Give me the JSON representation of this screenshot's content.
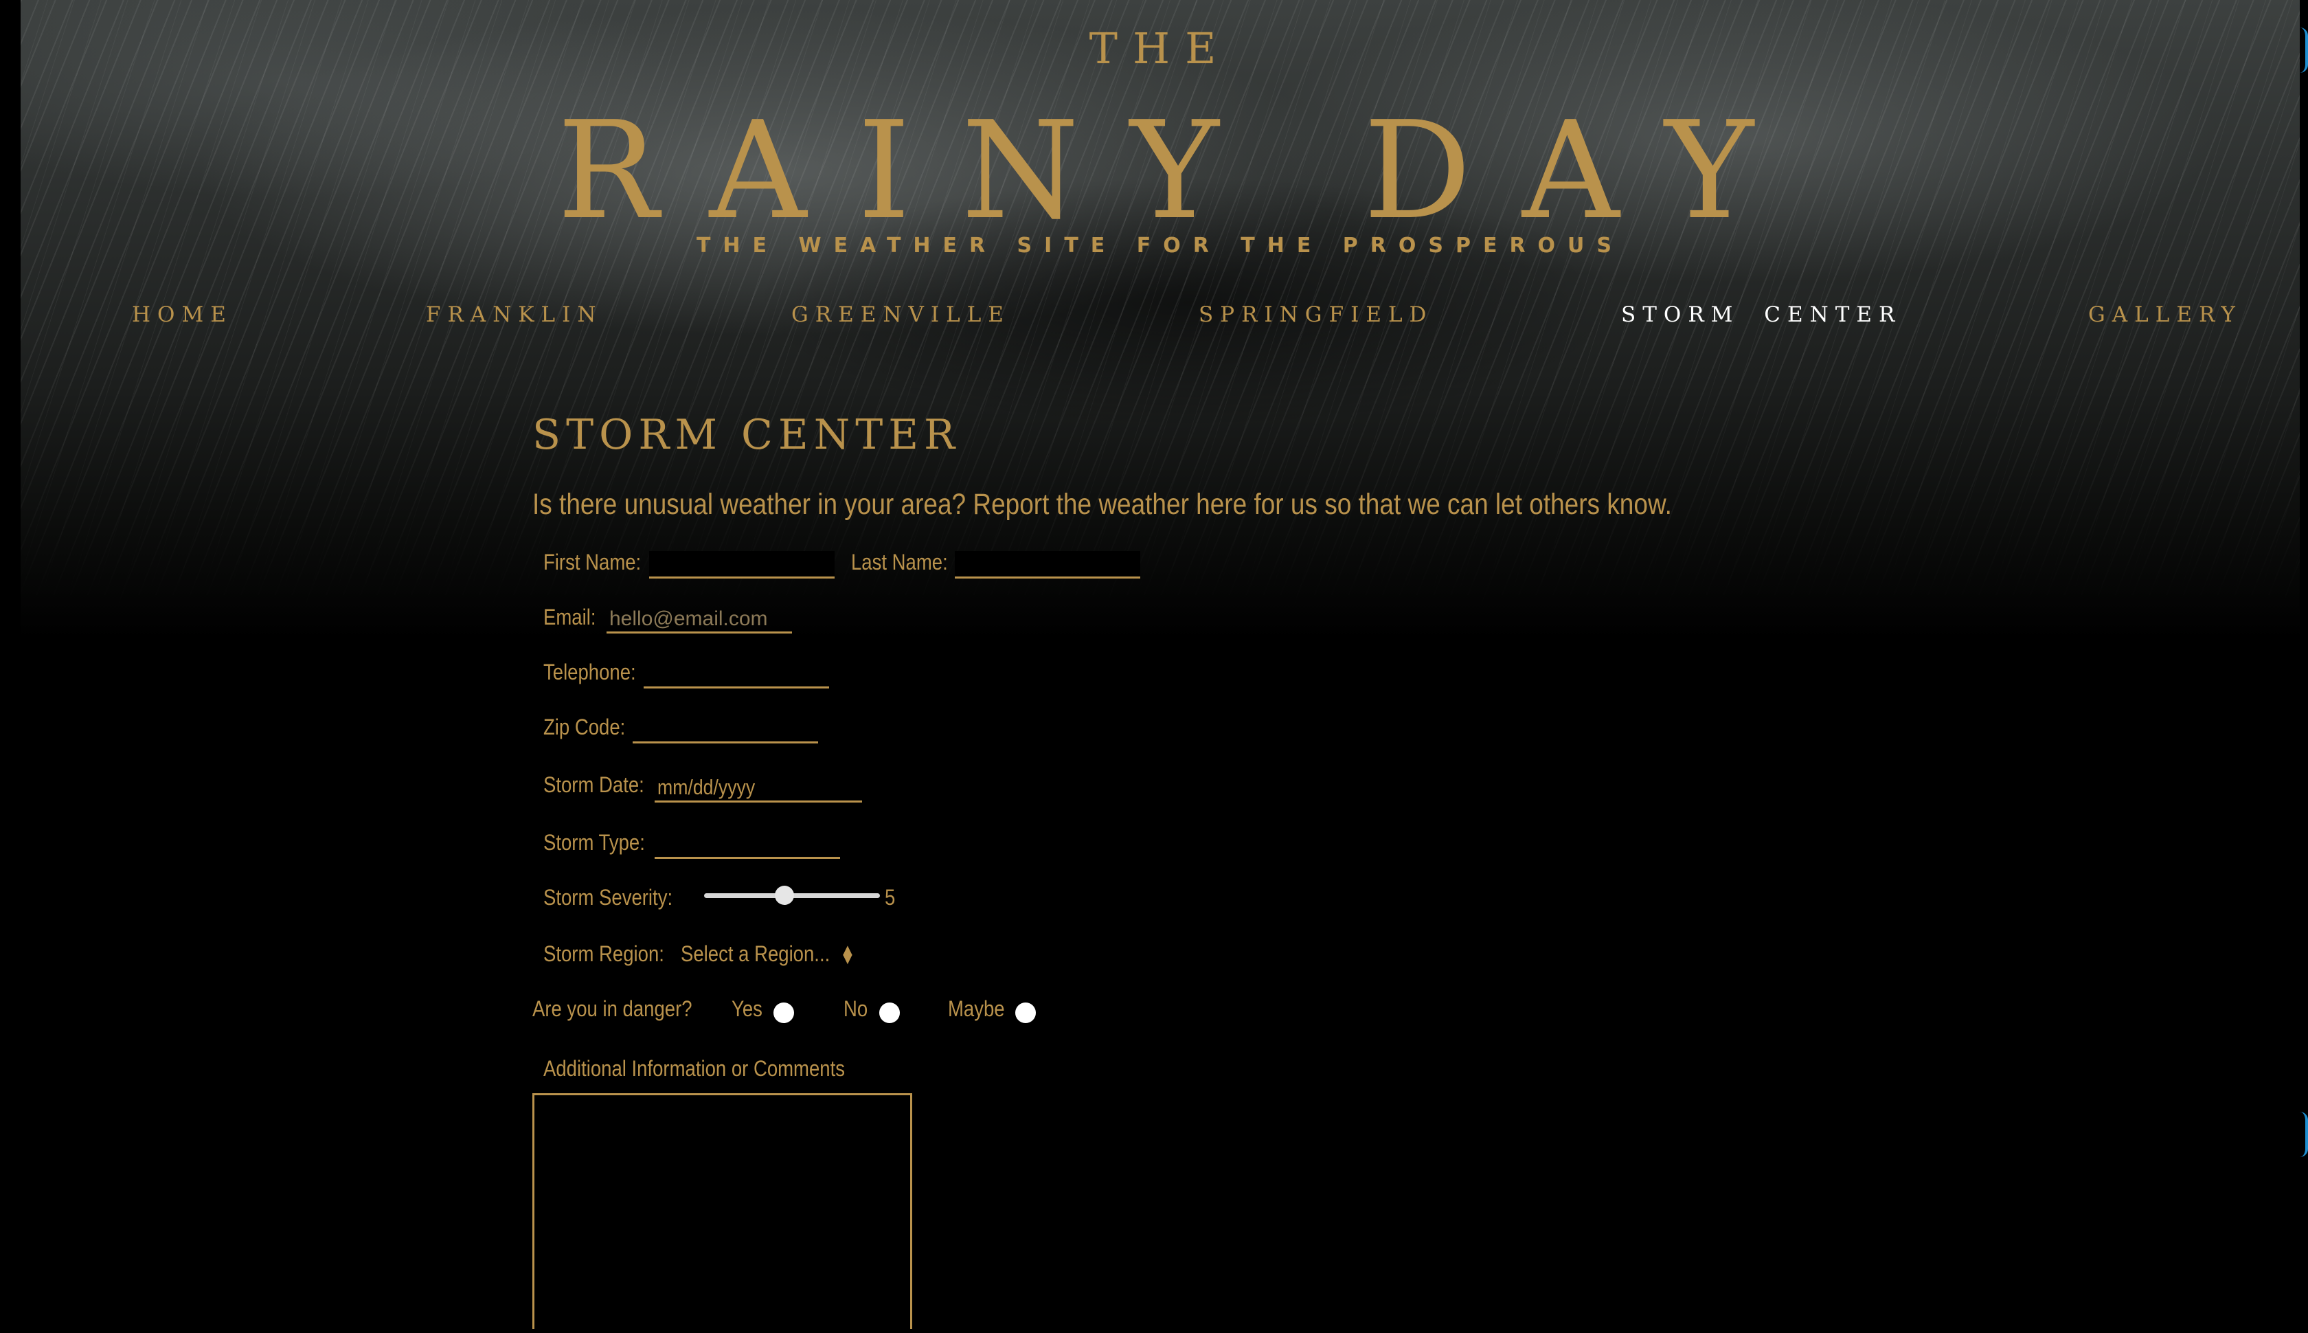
{
  "site": {
    "logo_the": "THE",
    "logo_main": "RAINY DAY",
    "tagline": "THE WEATHER SITE FOR THE PROSPEROUS"
  },
  "nav": {
    "items": [
      {
        "label": "HOME"
      },
      {
        "label": "FRANKLIN"
      },
      {
        "label": "GREENVILLE"
      },
      {
        "label": "SPRINGFIELD"
      },
      {
        "label": "STORM CENTER",
        "active": true
      },
      {
        "label": "GALLERY"
      }
    ]
  },
  "storm_center": {
    "title": "STORM CENTER",
    "intro": "Is there unusual weather in your area? Report the weather here for us so that we can let others know."
  },
  "form": {
    "first_name_label": "First Name:",
    "first_name_value": "",
    "last_name_label": "Last Name:",
    "last_name_value": "",
    "email_label": "Email:",
    "email_placeholder": "hello@email.com",
    "telephone_label": "Telephone:",
    "telephone_value": "",
    "zip_label": "Zip Code:",
    "zip_value": "",
    "storm_date_label": "Storm Date:",
    "storm_date_placeholder": "mm/dd/yyyy",
    "storm_type_label": "Storm Type:",
    "storm_type_value": "",
    "severity_label": "Storm Severity:",
    "severity_value": "5",
    "severity_fraction": 0.45,
    "region_label": "Storm Region:",
    "region_selected": "Select a Region...",
    "danger_label": "Are you in danger?",
    "danger_options": [
      "Yes",
      "No",
      "Maybe"
    ],
    "comments_label": "Additional Information or Comments",
    "comments_value": ""
  },
  "colors": {
    "accent_gold": "#b9924c",
    "active_nav": "#ffffff",
    "background": "#000000"
  }
}
